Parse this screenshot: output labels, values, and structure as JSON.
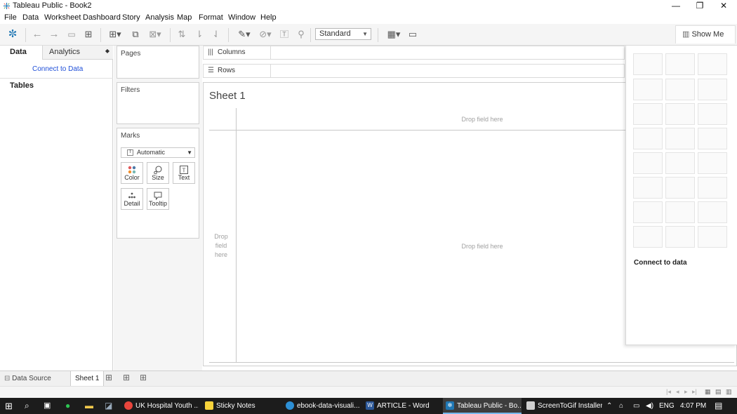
{
  "window": {
    "title": "Tableau Public - Book2",
    "minimize": "—",
    "restore": "❐",
    "close": "✕"
  },
  "menu": [
    "File",
    "Data",
    "Worksheet",
    "Dashboard",
    "Story",
    "Analysis",
    "Map",
    "Format",
    "Window",
    "Help"
  ],
  "toolbar": {
    "fit_select": "Standard",
    "show_me_label": "Show Me"
  },
  "data_pane": {
    "tab_data": "Data",
    "tab_analytics": "Analytics",
    "connect_link": "Connect to Data",
    "tables_label": "Tables"
  },
  "cards": {
    "pages": "Pages",
    "filters": "Filters",
    "marks": "Marks",
    "mark_type": "Automatic",
    "buttons": [
      "Color",
      "Size",
      "Text",
      "Detail",
      "Tooltip"
    ]
  },
  "shelves": {
    "columns": "Columns",
    "rows": "Rows"
  },
  "canvas": {
    "sheet_title": "Sheet 1",
    "drop_top": "Drop field here",
    "drop_left": "Drop field here",
    "drop_center": "Drop field here"
  },
  "show_me": {
    "connect_label": "Connect to data"
  },
  "sheet_tabs": {
    "data_source": "Data Source",
    "active": "Sheet 1"
  },
  "taskbar": {
    "apps": [
      {
        "label": "UK Hospital Youth ...",
        "icon": "chrome-icon",
        "color": "#e8453c"
      },
      {
        "label": "Sticky Notes",
        "icon": "sticky-notes-icon",
        "color": "#f7d33b"
      },
      {
        "label": "ebook-data-visuali...",
        "icon": "edge-icon",
        "color": "#2d8fd5"
      },
      {
        "label": "ARTICLE - Word",
        "icon": "word-icon",
        "color": "#2b5797"
      },
      {
        "label": "Tableau Public - Bo...",
        "icon": "tableau-icon",
        "color": "#1f77b4"
      },
      {
        "label": "ScreenToGif Installer",
        "icon": "installer-icon",
        "color": "#cfcfcf"
      }
    ],
    "lang": "ENG",
    "time": "4:07 PM"
  },
  "colors": {
    "link": "#1f4fd8",
    "taskbar_bg": "#1c1c1c",
    "accent": "#76b9ed"
  }
}
